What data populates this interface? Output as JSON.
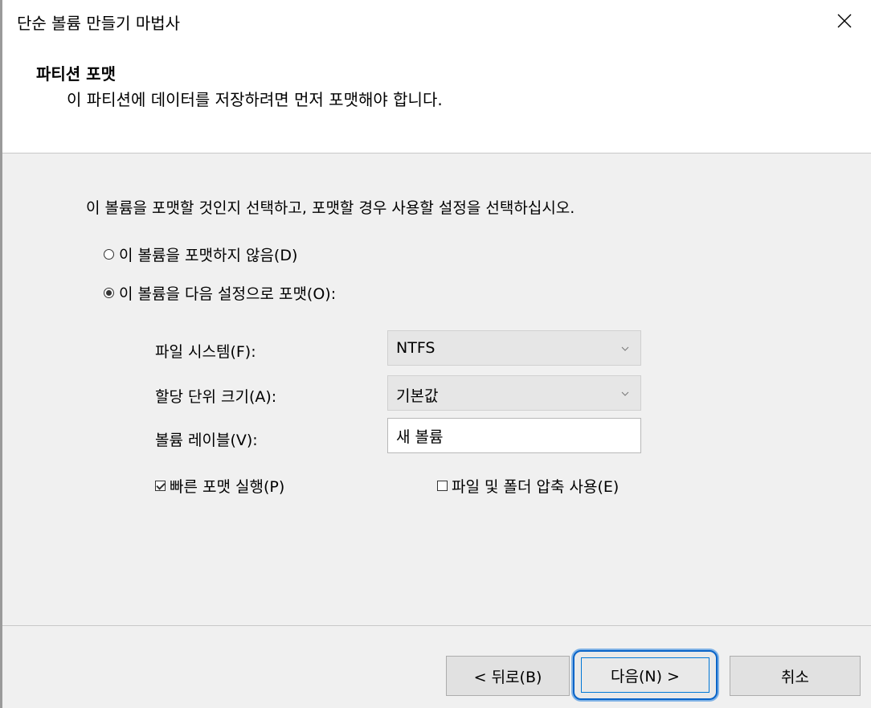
{
  "window": {
    "title": "단순 볼륨 만들기 마법사"
  },
  "header": {
    "title": "파티션 포맷",
    "subtitle": "이 파티션에 데이터를 저장하려면 먼저 포맷해야 합니다."
  },
  "content": {
    "instruction": "이 볼륨을 포맷할 것인지 선택하고, 포맷할 경우 사용할 설정을 선택하십시오.",
    "radio_no_format": {
      "label": "이 볼륨을 포맷하지 않음(D)",
      "checked": false
    },
    "radio_format": {
      "label": "이 볼륨을 다음 설정으로 포맷(O):",
      "checked": true
    },
    "file_system": {
      "label": "파일 시스템(F):",
      "value": "NTFS"
    },
    "allocation_unit": {
      "label": "할당 단위 크기(A):",
      "value": "기본값"
    },
    "volume_label": {
      "label": "볼륨 레이블(V):",
      "value": "새 볼륨"
    },
    "quick_format": {
      "label": "빠른 포맷 실행(P)",
      "checked": true
    },
    "compression": {
      "label": "파일 및 폴더 압축 사용(E)",
      "checked": false
    }
  },
  "footer": {
    "back_label": "< 뒤로(B)",
    "next_label": "다음(N) >",
    "cancel_label": "취소"
  },
  "icons": {
    "close": "close-icon",
    "dropdown": "chevron-down-icon"
  },
  "colors": {
    "content_bg": "#f0f0f0",
    "focus_blue": "#0078d7"
  }
}
